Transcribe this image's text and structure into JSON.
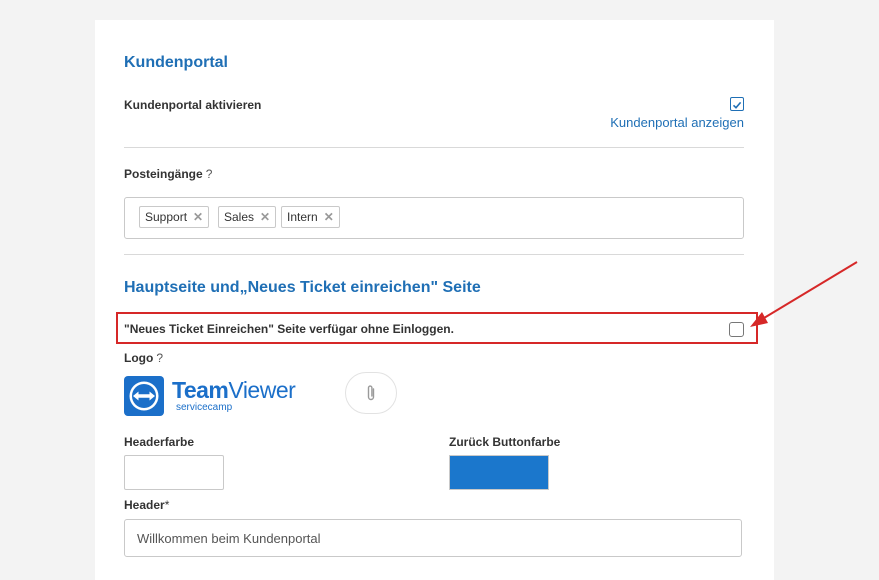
{
  "portal": {
    "title": "Kundenportal",
    "activate_label": "Kundenportal aktivieren",
    "activate_checked": true,
    "show_link": "Kundenportal anzeigen"
  },
  "inboxes": {
    "label": "Posteingänge",
    "help": "?",
    "tags": [
      "Support",
      "Sales",
      "Intern"
    ]
  },
  "mainpage": {
    "title": "Hauptseite und„Neues Ticket einreichen\" Seite",
    "no_login_label": "\"Neues Ticket Einreichen\" Seite verfügar ohne Einloggen.",
    "no_login_checked": false
  },
  "logo": {
    "label": "Logo",
    "help": "?",
    "brand_team": "Team",
    "brand_viewer": "Viewer",
    "brand_sub": "servicecamp"
  },
  "colors": {
    "header_label": "Headerfarbe",
    "header_color": "#ffffff",
    "back_label": "Zurück Buttonfarbe",
    "back_color": "#1b77cc"
  },
  "header": {
    "label": "Header",
    "required": "*",
    "value": "Willkommen beim Kundenportal"
  },
  "annotation": {
    "color": "#d62828"
  }
}
